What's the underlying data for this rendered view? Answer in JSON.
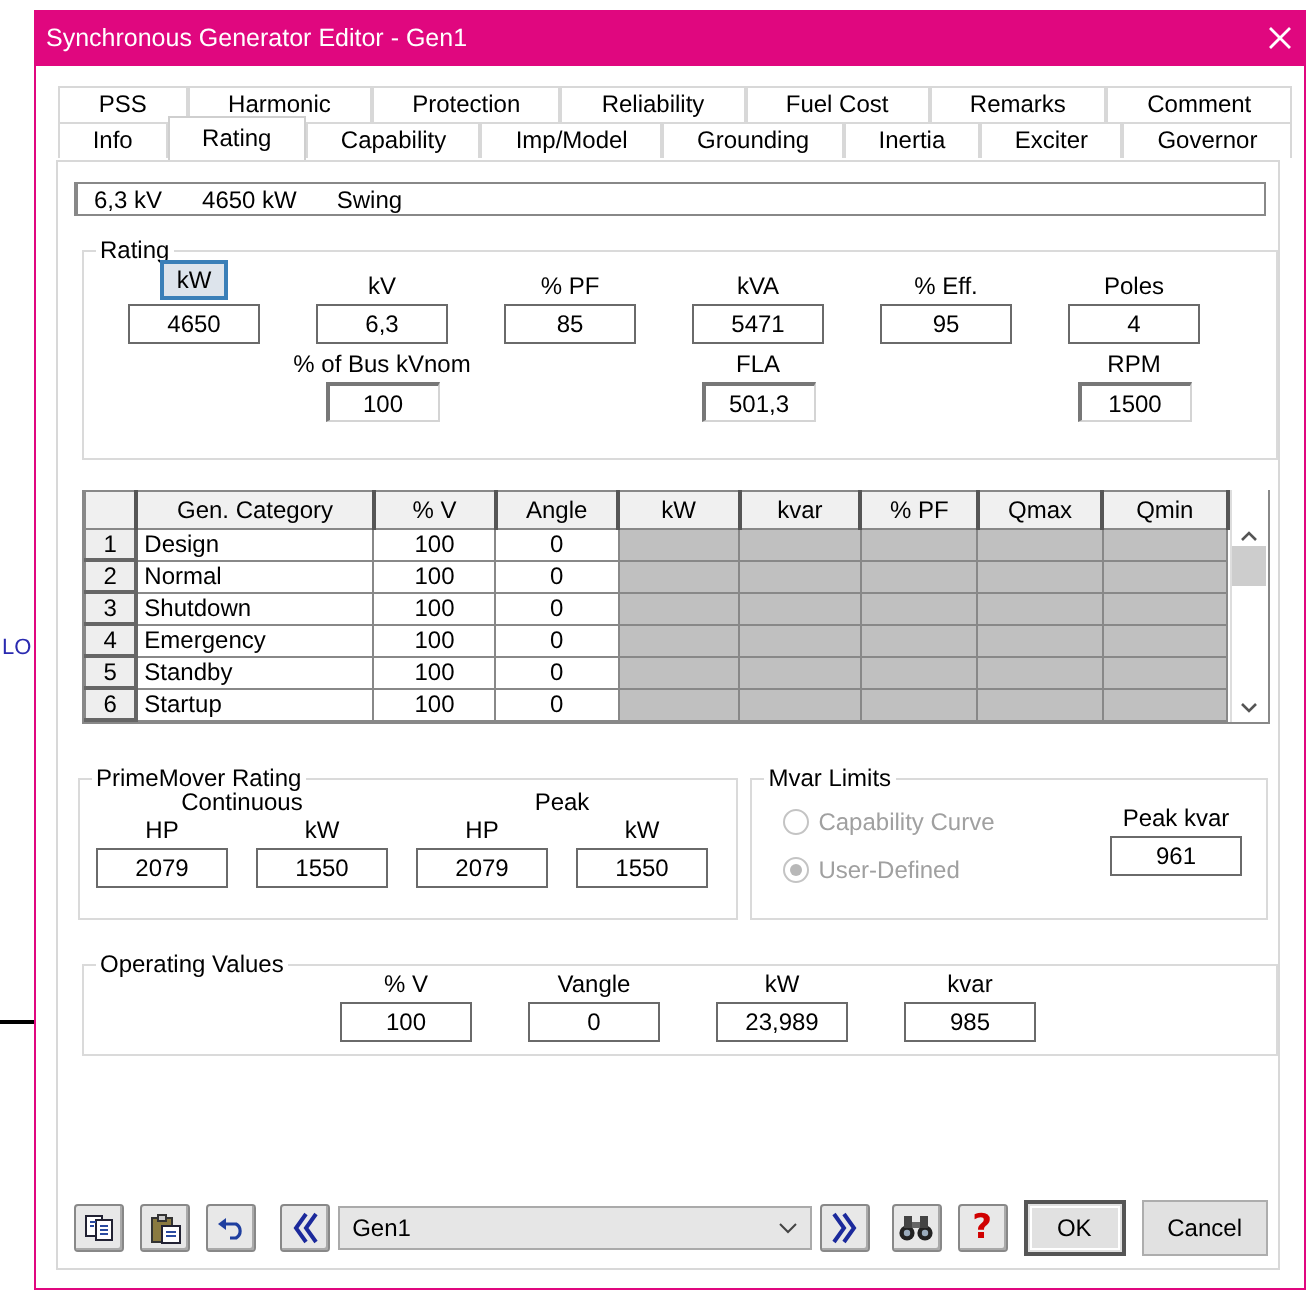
{
  "background": {
    "fragment": "LO"
  },
  "window": {
    "title": "Synchronous Generator Editor - Gen1"
  },
  "tabs_row_1": [
    {
      "label": "PSS",
      "selected": false
    },
    {
      "label": "Harmonic",
      "selected": false
    },
    {
      "label": "Protection",
      "selected": false
    },
    {
      "label": "Reliability",
      "selected": false
    },
    {
      "label": "Fuel Cost",
      "selected": false
    },
    {
      "label": "Remarks",
      "selected": false
    },
    {
      "label": "Comment",
      "selected": false
    }
  ],
  "tabs_row_2": [
    {
      "label": "Info",
      "selected": false
    },
    {
      "label": "Rating",
      "selected": true
    },
    {
      "label": "Capability",
      "selected": false
    },
    {
      "label": "Imp/Model",
      "selected": false
    },
    {
      "label": "Grounding",
      "selected": false
    },
    {
      "label": "Inertia",
      "selected": false
    },
    {
      "label": "Exciter",
      "selected": false
    },
    {
      "label": "Governor",
      "selected": false
    }
  ],
  "summary": [
    "6,3 kV",
    "4650 kW",
    "Swing"
  ],
  "rating": {
    "title": "Rating",
    "columns": [
      {
        "top": {
          "label": "kW",
          "kind": "button",
          "value": "4650"
        }
      },
      {
        "top": {
          "label": "kV",
          "kind": "text",
          "value": "6,3"
        },
        "bottom": {
          "label": "% of Bus kVnom",
          "kind": "text",
          "value": "100",
          "readonly": true
        }
      },
      {
        "top": {
          "label": "% PF",
          "kind": "text",
          "value": "85"
        }
      },
      {
        "top": {
          "label": "kVA",
          "kind": "text",
          "value": "5471"
        },
        "bottom": {
          "label": "FLA",
          "kind": "text",
          "value": "501,3",
          "readonly": true
        }
      },
      {
        "top": {
          "label": "% Eff.",
          "kind": "text",
          "value": "95"
        }
      },
      {
        "top": {
          "label": "Poles",
          "kind": "text",
          "value": "4"
        },
        "bottom": {
          "label": "RPM",
          "kind": "text",
          "value": "1500",
          "readonly": true
        }
      }
    ]
  },
  "table": {
    "columns": [
      "Gen. Category",
      "% V",
      "Angle",
      "kW",
      "kvar",
      "% PF",
      "Qmax",
      "Qmin"
    ],
    "rows": [
      {
        "number": "1",
        "category": "Design",
        "v": "100",
        "angle": "0"
      },
      {
        "number": "2",
        "category": "Normal",
        "v": "100",
        "angle": "0"
      },
      {
        "number": "3",
        "category": "Shutdown",
        "v": "100",
        "angle": "0"
      },
      {
        "number": "4",
        "category": "Emergency",
        "v": "100",
        "angle": "0"
      },
      {
        "number": "5",
        "category": "Standby",
        "v": "100",
        "angle": "0"
      },
      {
        "number": "6",
        "category": "Startup",
        "v": "100",
        "angle": "0"
      }
    ]
  },
  "primemover": {
    "title": "PrimeMover Rating",
    "groups": [
      {
        "label": "Continuous",
        "fields": [
          {
            "label": "HP",
            "kind": "text",
            "value": "2079"
          },
          {
            "label": "kW",
            "kind": "text",
            "value": "1550"
          }
        ]
      },
      {
        "label": "Peak",
        "fields": [
          {
            "label": "HP",
            "kind": "text",
            "value": "2079"
          },
          {
            "label": "kW",
            "kind": "text",
            "value": "1550"
          }
        ]
      }
    ]
  },
  "mvar_limits": {
    "title": "Mvar Limits",
    "options": [
      {
        "label": "Capability Curve",
        "selected": false,
        "disabled": true
      },
      {
        "label": "User-Defined",
        "selected": true,
        "disabled": true
      }
    ],
    "peak": {
      "label": "Peak kvar",
      "kind": "text",
      "value": "961"
    }
  },
  "operating_values": {
    "title": "Operating Values",
    "fields": [
      {
        "label": "% V",
        "kind": "text",
        "value": "100"
      },
      {
        "label": "Vangle",
        "kind": "text",
        "value": "0"
      },
      {
        "label": "kW",
        "kind": "text",
        "value": "23,989"
      },
      {
        "label": "kvar",
        "kind": "text",
        "value": "985"
      }
    ]
  },
  "footer": {
    "navigator": "Gen1",
    "help_glyph": "?",
    "buttons": [
      "OK",
      "Cancel"
    ]
  }
}
